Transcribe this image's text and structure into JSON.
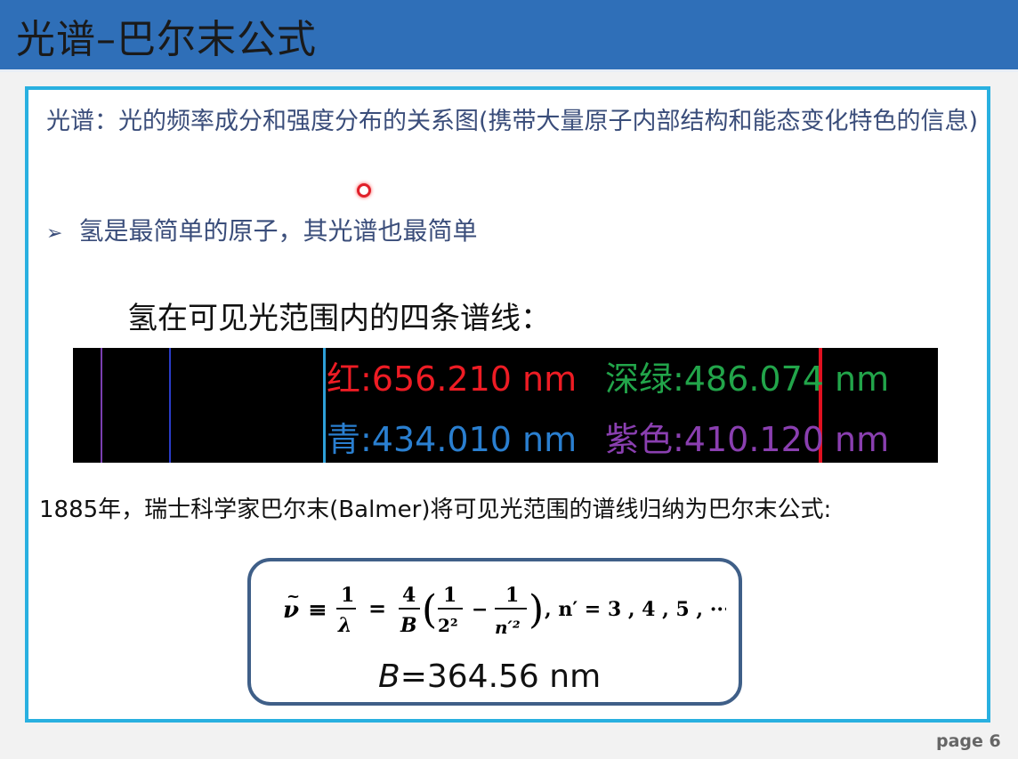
{
  "slide": {
    "title": "光谱–巴尔末公式",
    "definition": "光谱：光的频率成分和强度分布的关系图(携带大量原子内部结构和能态变化特色的信息)",
    "bullet": "氢是最简单的原子，其光谱也最简单",
    "lines_heading": "氢在可见光范围内的四条谱线：",
    "spectrum_labels": {
      "red": "红:656.210 nm",
      "green": "深绿:486.074 nm",
      "cyan": "青:434.010  nm",
      "purple": "紫色:410.120 nm"
    },
    "history": "1885年，瑞士科学家巴尔末(Balmer)将可见光范围的谱线归纳为巴尔末公式:",
    "formula": {
      "nu": "ν",
      "equiv": "≡",
      "one": "1",
      "lambda": "λ",
      "four": "4",
      "B": "B",
      "two_sq": "2²",
      "n_sq": "n′²",
      "tail": ", n′ = 3 , 4 , 5 , ···"
    },
    "b_var": "B",
    "b_rest": "=364.56 nm",
    "page": "page 6"
  },
  "colors": {
    "title_bar": "#2f6fb8",
    "frame": "#29b0e0",
    "red": "#ee1c24",
    "green": "#22a54a",
    "cyan": "#2a7fd0",
    "purple": "#8a3fb0"
  }
}
